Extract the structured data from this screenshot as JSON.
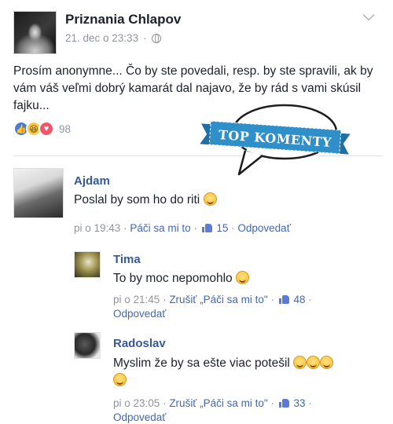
{
  "post": {
    "page_name": "Priznania Chlapov",
    "timestamp": "21. dec o 23:33",
    "meta_separator": "·",
    "text": "Prosím anonymne... Čo by ste povedali, resp. by ste spravili, ak by vám váš veľmi dobrý kamarát dal najavo, že by rád s vami skúsil fajku...",
    "reaction_count": "98",
    "icons": [
      "globe-icon",
      "chevron-down-icon",
      "like-reaction-icon",
      "haha-reaction-icon",
      "love-reaction-icon"
    ]
  },
  "banner": {
    "text": "TOP KOMENTY",
    "color": "#2f8fc9"
  },
  "comments": [
    {
      "author": "Ajdam",
      "text": "Poslal by som ho do riti",
      "time": "pi o 19:43",
      "like_action": "Páči sa mi to",
      "likes": "15",
      "reply": "Odpovedať"
    },
    {
      "author": "Tima",
      "text": "To by moc nepomohlo",
      "time": "pi o 21:45",
      "like_action": "Zrušiť „Páči sa mi to\"",
      "likes": "48",
      "reply": "Odpovedať"
    },
    {
      "author": "Radoslav",
      "text": "Myslim že by sa ešte viac potešil",
      "time": "pi o 23:05",
      "like_action": "Zrušiť „Páči sa mi to\"",
      "likes": "33",
      "reply": "Odpovedať"
    }
  ],
  "colors": {
    "link": "#4267b2",
    "name": "#365899",
    "meta": "#90949c",
    "text": "#1d2129"
  }
}
